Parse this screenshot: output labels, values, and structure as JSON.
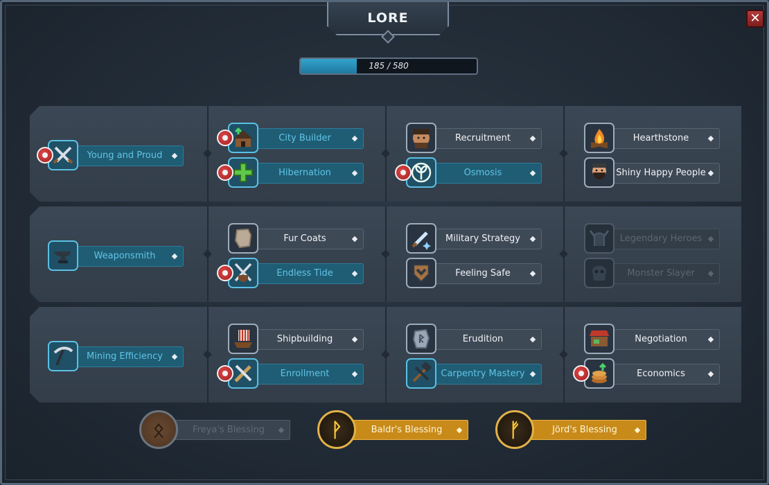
{
  "title": "LORE",
  "close_label": "✕",
  "progress": {
    "current": 185,
    "max": 580,
    "text": "185 / 580"
  },
  "colors": {
    "accent_blue": "#5bc0e4",
    "gold": "#c88a19",
    "requirement_red": "#c0302f"
  },
  "rows": [
    {
      "cols": [
        [
          {
            "label": "Young and Proud",
            "icon": "crossed-swords-icon",
            "state": "blue",
            "req": true
          }
        ],
        [
          {
            "label": "City Builder",
            "icon": "house-upgrade-icon",
            "state": "blue",
            "req": true
          },
          {
            "label": "Hibernation",
            "icon": "green-cross-icon",
            "state": "blue",
            "req": true
          }
        ],
        [
          {
            "label": "Recruitment",
            "icon": "warrior-face-icon",
            "state": "normal",
            "req": false
          },
          {
            "label": "Osmosis",
            "icon": "sprout-icon",
            "state": "blue",
            "req": true
          }
        ],
        [
          {
            "label": "Hearthstone",
            "icon": "campfire-icon",
            "state": "normal",
            "req": false
          },
          {
            "label": "Shiny Happy People",
            "icon": "bearded-viking-icon",
            "state": "normal",
            "req": false
          }
        ]
      ]
    },
    {
      "cols": [
        [
          {
            "label": "Weaponsmith",
            "icon": "anvil-icon",
            "state": "blue",
            "req": false
          }
        ],
        [
          {
            "label": "Fur Coats",
            "icon": "fur-pelt-icon",
            "state": "normal",
            "req": false
          },
          {
            "label": "Endless Tide",
            "icon": "shield-swords-icon",
            "state": "blue",
            "req": true
          }
        ],
        [
          {
            "label": "Military Strategy",
            "icon": "sword-sparkle-icon",
            "state": "normal",
            "req": false
          },
          {
            "label": "Feeling Safe",
            "icon": "chevron-shield-icon",
            "state": "normal",
            "req": false
          }
        ],
        [
          {
            "label": "Legendary Heroes",
            "icon": "winged-helmet-icon",
            "state": "dim",
            "req": false
          },
          {
            "label": "Monster Slayer",
            "icon": "monster-skull-icon",
            "state": "dim",
            "req": false
          }
        ]
      ]
    },
    {
      "cols": [
        [
          {
            "label": "Mining Efficiency",
            "icon": "pickaxe-icon",
            "state": "blue",
            "req": false
          }
        ],
        [
          {
            "label": "Shipbuilding",
            "icon": "viking-ship-icon",
            "state": "normal",
            "req": false
          },
          {
            "label": "Enrollment",
            "icon": "crossed-weapons-icon",
            "state": "blue",
            "req": true
          }
        ],
        [
          {
            "label": "Erudition",
            "icon": "runestone-icon",
            "state": "normal",
            "req": false
          },
          {
            "label": "Carpentry Mastery",
            "icon": "hammer-chisel-icon",
            "state": "blue",
            "req": false
          }
        ],
        [
          {
            "label": "Negotiation",
            "icon": "market-stall-icon",
            "state": "normal",
            "req": false
          },
          {
            "label": "Economics",
            "icon": "coin-stack-icon",
            "state": "normal",
            "req": true
          }
        ]
      ]
    }
  ],
  "blessings": [
    {
      "label": "Freya's Blessing",
      "rune": "ᛟ",
      "state": "dim"
    },
    {
      "label": "Baldr's Blessing",
      "rune": "ᚹ",
      "state": "active"
    },
    {
      "label": "Jörd's Blessing",
      "rune": "ᚠ",
      "state": "active"
    }
  ]
}
